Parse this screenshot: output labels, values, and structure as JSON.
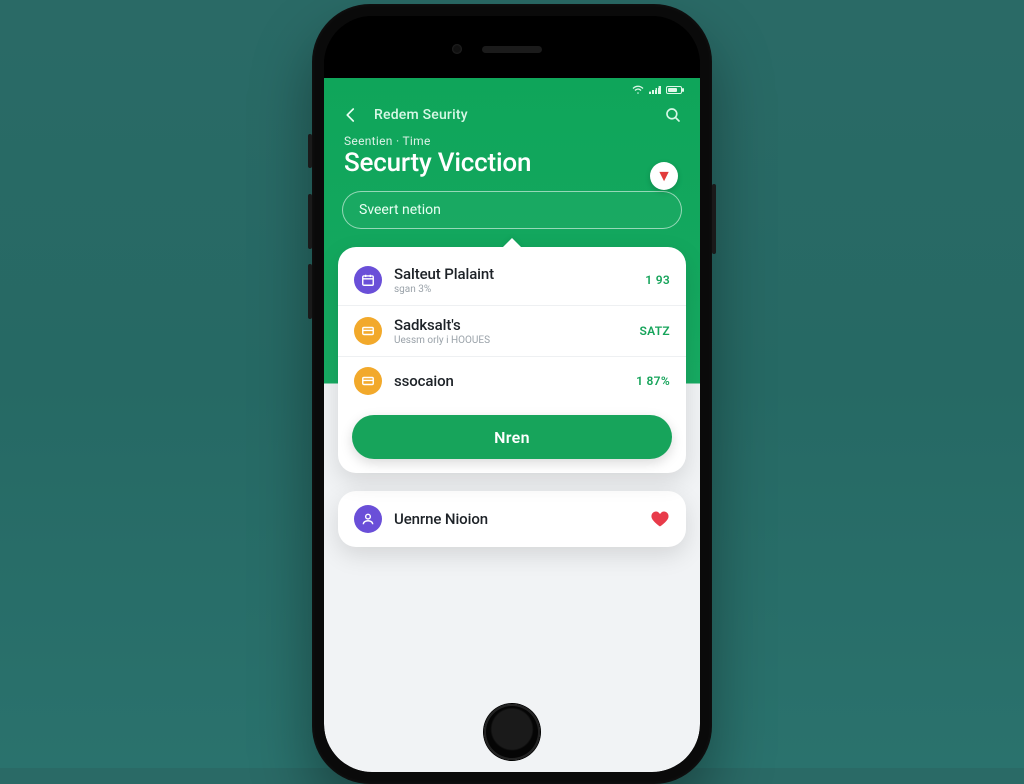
{
  "colors": {
    "brand": "#17a45b",
    "accent_red": "#e83b4a",
    "bg_teal": "#276a66"
  },
  "statusbar": {
    "label": "status-bar"
  },
  "topbar": {
    "back_label": "Back",
    "title": "Redem Seurity",
    "search_label": "Search"
  },
  "hero": {
    "eyebrow": "Seentien · Time",
    "title": "Securty Vicction",
    "alert_glyph": "▼"
  },
  "pill": {
    "placeholder": "Sveert netion"
  },
  "list": {
    "items": [
      {
        "icon": "calendar-icon",
        "icon_color": "purple",
        "title": "Salteut Plalaint",
        "sub": "sgan 3%",
        "value": "1 93"
      },
      {
        "icon": "card-icon",
        "icon_color": "amber",
        "title": "Sadksalt's",
        "sub": "Uessm orly i HOOUES",
        "value": "SATZ"
      },
      {
        "icon": "card-icon",
        "icon_color": "amber2",
        "title": "ssocaion",
        "sub": "",
        "value": "1 87%"
      }
    ]
  },
  "cta": {
    "label": "Nren"
  },
  "below": {
    "items": [
      {
        "icon": "user-icon",
        "icon_color": "purple2",
        "title": "Uenrne Nioion",
        "heart": true
      }
    ]
  }
}
